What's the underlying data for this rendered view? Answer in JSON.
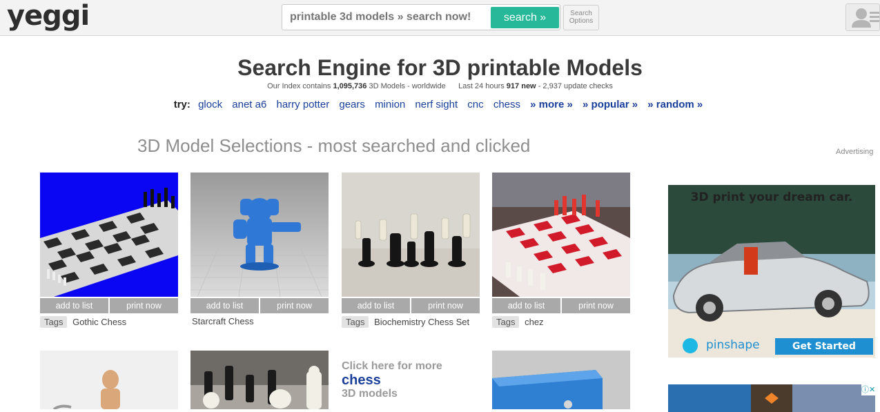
{
  "header": {
    "logo_text": "yeggi",
    "search_placeholder": "printable 3d models » search now!",
    "search_button": "search »",
    "options_line1": "Search",
    "options_line2": "Options"
  },
  "hero": {
    "title": "Search Engine for 3D printable Models",
    "stats_prefix": "Our Index contains",
    "index_count": "1,095,736",
    "stats_mid": "3D Models - worldwide",
    "last24_label": "Last 24 hours",
    "new_count": "917",
    "new_label": "new",
    "update_checks": "- 2,937 update checks"
  },
  "try_bar": {
    "label": "try:",
    "links": [
      "glock",
      "anet a6",
      "harry potter",
      "gears",
      "minion",
      "nerf sight",
      "cnc",
      "chess"
    ],
    "more": "» more »",
    "popular": "» popular »",
    "random": "» random »"
  },
  "section": {
    "title": "3D Model Selections - most searched and clicked",
    "advertising_label": "Advertising"
  },
  "card_actions": {
    "add": "add to list",
    "print": "print now"
  },
  "tags_label": "Tags",
  "cards": [
    {
      "title": "Gothic Chess",
      "has_tags": true
    },
    {
      "title": "Starcraft Chess",
      "has_tags": false
    },
    {
      "title": "Biochemistry Chess Set",
      "has_tags": true
    },
    {
      "title": "chez",
      "has_tags": true
    }
  ],
  "more_box": {
    "line1": "Click here for more",
    "line2": "chess",
    "line3": "3D models"
  },
  "ads": {
    "ad1_headline": "3D print your dream car.",
    "ad1_brand": "pinshape",
    "ad1_cta": "Get Started"
  },
  "colors": {
    "accent_green": "#27b899",
    "link_blue": "#1a3f9b",
    "action_gray": "#a9a9a9"
  }
}
